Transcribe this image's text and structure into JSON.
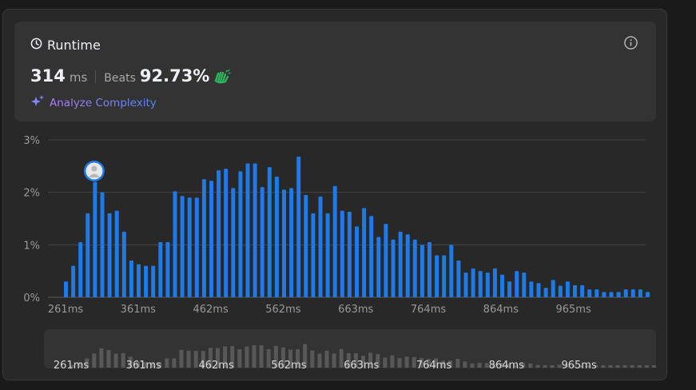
{
  "runtime": {
    "title": "Runtime",
    "value": "314",
    "unit": "ms",
    "beats_label": "Beats",
    "beats_value": "92.73%",
    "analyze_label": "Analyze Complexity"
  },
  "icons": {
    "clock": "clock-icon",
    "info": "info-icon",
    "clap": "clap-icon",
    "sparkle": "sparkle-icon",
    "avatar": "avatar-icon"
  },
  "colors": {
    "bar": "#1e7ae8",
    "mini_bar": "#585858",
    "clap": "#2db55d"
  },
  "chart_data": {
    "type": "bar",
    "title": "",
    "xlabel": "",
    "ylabel": "",
    "y_tick_labels": [
      "0%",
      "1%",
      "2%",
      "3%"
    ],
    "x_tick_labels": [
      "261ms",
      "361ms",
      "462ms",
      "562ms",
      "663ms",
      "764ms",
      "864ms",
      "965ms"
    ],
    "ylim": [
      0,
      3
    ],
    "grid": true,
    "highlight_index": 4,
    "values": [
      0.3,
      0.6,
      1.05,
      1.6,
      2.2,
      2.0,
      1.6,
      1.65,
      1.25,
      0.7,
      0.63,
      0.6,
      0.6,
      1.05,
      1.05,
      2.02,
      1.93,
      1.9,
      1.9,
      2.25,
      2.22,
      2.42,
      2.45,
      2.08,
      2.4,
      2.55,
      2.55,
      2.1,
      2.48,
      2.3,
      2.05,
      2.08,
      2.68,
      1.95,
      1.6,
      1.92,
      1.6,
      2.12,
      1.65,
      1.63,
      1.35,
      1.7,
      1.55,
      1.15,
      1.4,
      1.1,
      1.25,
      1.2,
      1.1,
      1.0,
      1.05,
      0.8,
      0.8,
      1.0,
      0.7,
      0.47,
      0.55,
      0.5,
      0.47,
      0.55,
      0.43,
      0.3,
      0.5,
      0.47,
      0.3,
      0.27,
      0.18,
      0.33,
      0.22,
      0.3,
      0.23,
      0.23,
      0.15,
      0.15,
      0.1,
      0.1,
      0.1,
      0.15,
      0.15,
      0.15,
      0.1
    ]
  }
}
